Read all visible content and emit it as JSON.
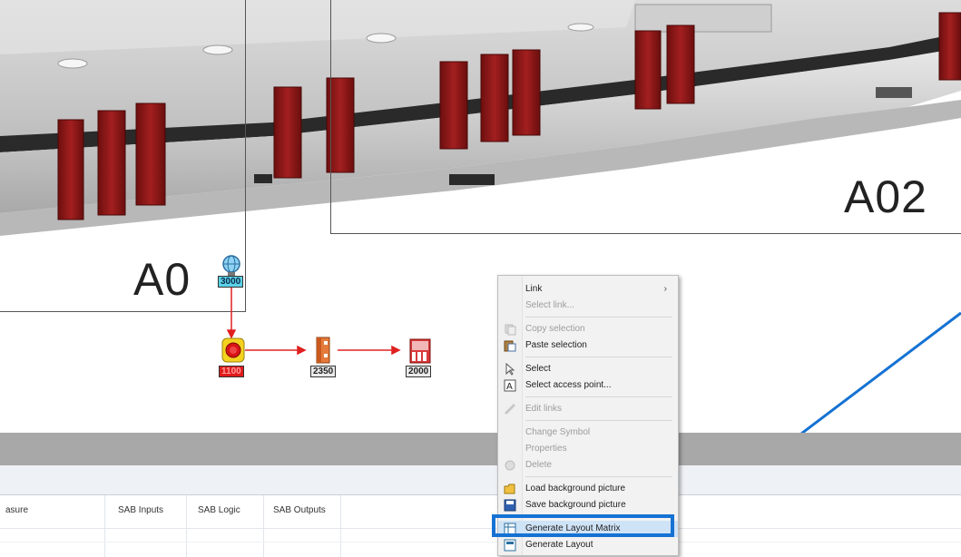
{
  "zones": {
    "left_label": "A0",
    "right_label": "A02"
  },
  "diagram": {
    "nodes": [
      {
        "id": "3000",
        "icon": "sensor-globe-icon"
      },
      {
        "id": "1100",
        "icon": "emergency-stop-icon"
      },
      {
        "id": "2350",
        "icon": "safety-relay-icon"
      },
      {
        "id": "2000",
        "icon": "controller-module-icon"
      }
    ],
    "arrow_color": "#e02020"
  },
  "table": {
    "columns": [
      "asure",
      "SAB Inputs",
      "SAB Logic",
      "SAB Outputs"
    ]
  },
  "context_menu": {
    "items": [
      {
        "label": "Link",
        "enabled": true,
        "submenu": true
      },
      {
        "label": "Select link...",
        "enabled": false
      },
      {
        "label": "Copy selection",
        "enabled": false,
        "icon": "copy-icon"
      },
      {
        "label": "Paste selection",
        "enabled": true,
        "icon": "paste-icon"
      },
      {
        "label": "Select",
        "enabled": true,
        "icon": "select-cursor-icon"
      },
      {
        "label": "Select access point...",
        "enabled": true,
        "icon": "access-point-icon"
      },
      {
        "label": "Edit links",
        "enabled": false,
        "icon": "edit-links-icon"
      },
      {
        "label": "Change Symbol",
        "enabled": false
      },
      {
        "label": "Properties",
        "enabled": false
      },
      {
        "label": "Delete",
        "enabled": false,
        "icon": "delete-icon"
      },
      {
        "label": "Load background picture",
        "enabled": true,
        "icon": "folder-open-icon"
      },
      {
        "label": "Save background picture",
        "enabled": true,
        "icon": "save-icon"
      },
      {
        "label": "Generate Layout Matrix",
        "enabled": true,
        "icon": "layout-matrix-icon",
        "highlighted": true
      },
      {
        "label": "Generate Layout",
        "enabled": true,
        "icon": "layout-icon"
      }
    ]
  },
  "colors": {
    "highlight": "#1572d3",
    "callout_line": "#1572d3",
    "machine_red": "#8b1a1a"
  }
}
